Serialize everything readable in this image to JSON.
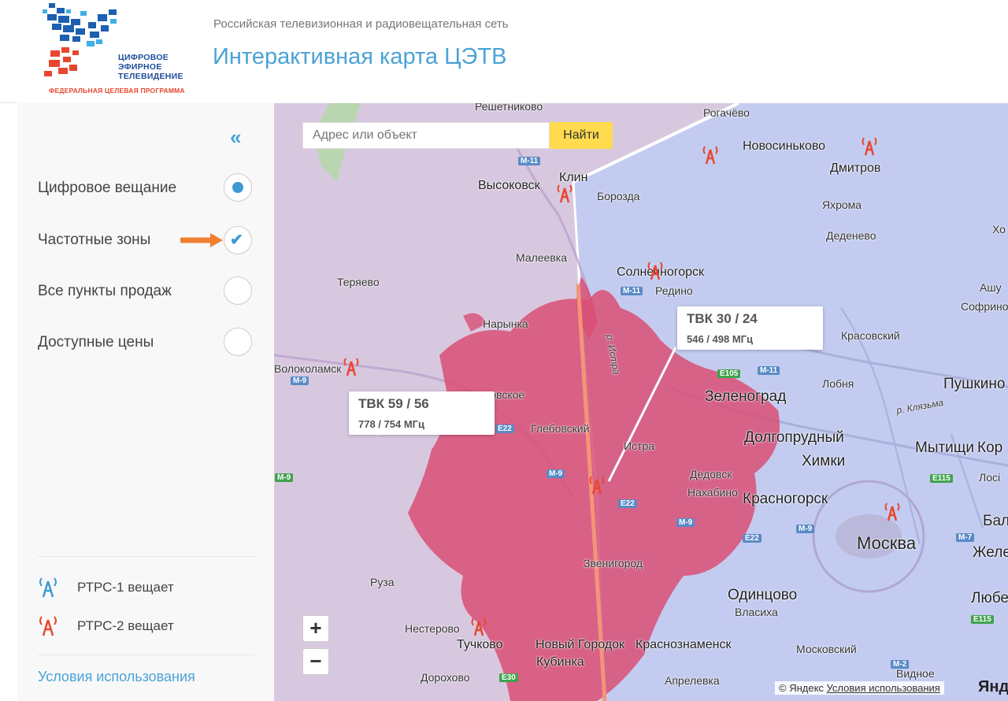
{
  "header": {
    "logo_lines": [
      "ЦИФРОВОЕ",
      "ЭФИРНОЕ",
      "ТЕЛЕВИДЕНИЕ"
    ],
    "logo_program": "ФЕДЕРАЛЬНАЯ ЦЕЛЕВАЯ ПРОГРАММА",
    "subtitle": "Российская телевизионная и радиовещательная сеть",
    "title": "Интерактивная карта ЦЭТВ"
  },
  "sidebar": {
    "collapse_label": "«",
    "layers": [
      {
        "label": "Цифровое вещание",
        "state": "selected"
      },
      {
        "label": "Частотные зоны",
        "state": "checked"
      },
      {
        "label": "Все пункты продаж",
        "state": "off"
      },
      {
        "label": "Доступные цены",
        "state": "off"
      }
    ],
    "legend": [
      {
        "label": "РТРС-1 вещает",
        "color": "#3d9bd2"
      },
      {
        "label": "РТРС-2 вещает",
        "color": "#e8472f"
      }
    ],
    "terms_link": "Условия использования"
  },
  "map": {
    "search": {
      "placeholder": "Адрес или объект",
      "button": "Найти"
    },
    "zoom": {
      "in": "+",
      "out": "−"
    },
    "zone_labels": [
      {
        "title": "ТВК 59 / 56",
        "freq": "778 / 754 МГц"
      },
      {
        "title": "ТВК 30 / 24",
        "freq": "546 / 498 МГц"
      }
    ],
    "places": [
      "Решетниково",
      "Рогачёво",
      "Новосиньково",
      "Дмитров",
      "Клин",
      "Высоковск",
      "Борозда",
      "Яхрома",
      "Деденево",
      "Хо",
      "Малеевка",
      "Солнечногорск",
      "Редино",
      "Ашу",
      "Софрино",
      "Теряево",
      "Нарынка",
      "Красовский",
      "Пушкино",
      "Лобня",
      "Волоколамск",
      "Зеленоград",
      "Долгопрудный",
      "Химки",
      "Мытищи",
      "Кор",
      "Глебовский",
      "Истра",
      "Дедовск",
      "Нахабино",
      "Красногорск",
      "Лосі",
      "Бала",
      "Москва",
      "Желез",
      "Звенигород",
      "Одинцово",
      "Люберц",
      "Руза",
      "Власиха",
      "Нестерово",
      "Тучково",
      "Новый Городок",
      "Краснознаменск",
      "Московский",
      "Кубинка",
      "Видное",
      "Дорохово",
      "Апрелевка",
      "ковское",
      "р. Истра",
      "р. Клязьма"
    ],
    "roads": [
      "M-11",
      "M-11",
      "M-9",
      "E22",
      "M-9",
      "E22",
      "M-9",
      "E22",
      "E105",
      "M-11",
      "E115",
      "M-7",
      "E115",
      "M-9",
      "E30",
      "M-2",
      "M-9"
    ],
    "copyright": "© Яндекс",
    "copyright_link": "Условия использования",
    "brand": "Янде"
  },
  "colors": {
    "accent": "#4aa3d6",
    "zone_purple": "#d8c8df",
    "zone_blue": "#c3ccf0",
    "coverage": "#d94f75",
    "search_button": "#ffdb4d"
  }
}
